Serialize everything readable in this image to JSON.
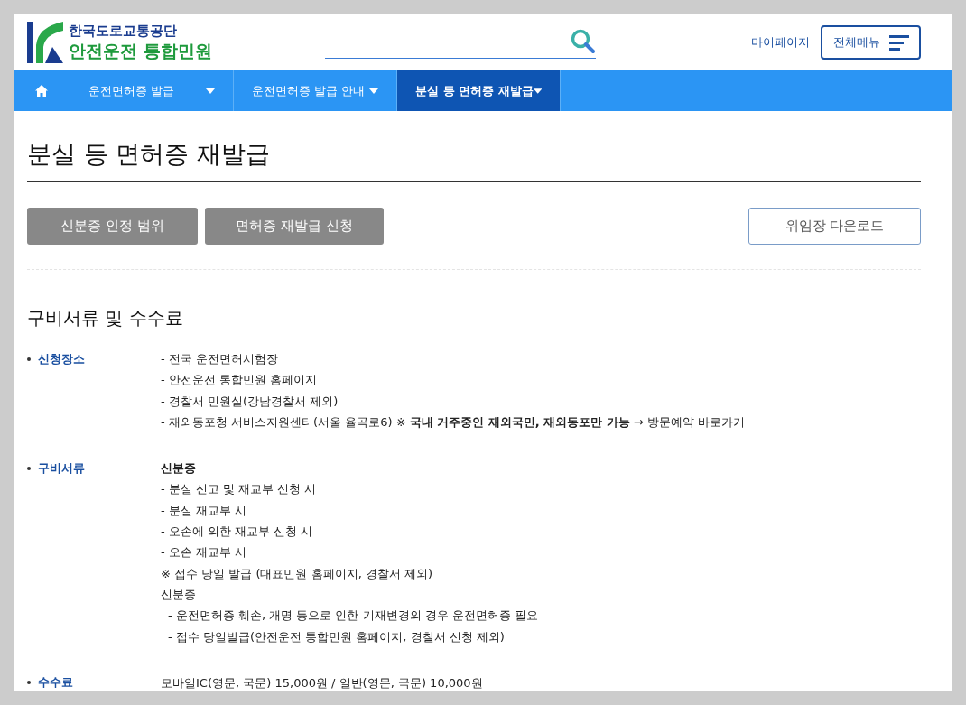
{
  "header": {
    "org_name": "한국도로교통공단",
    "site_name": "안전운전 통합민원",
    "mypage_link": "마이페이지",
    "menu_button": "전체메뉴"
  },
  "nav": [
    {
      "label": "운전면허증 발급",
      "selected": false
    },
    {
      "label": "운전면허증 발급 안내",
      "selected": false
    },
    {
      "label": "분실 등 면허증 재발급",
      "selected": true
    }
  ],
  "page_title": "분실 등 면허증 재발급",
  "action_buttons": [
    {
      "label": "신분증 인정 범위",
      "kind": "filled"
    },
    {
      "label": "면허증 재발급 신청",
      "kind": "filled"
    },
    {
      "label": "위임장 다운로드",
      "kind": "outline"
    }
  ],
  "section_title": "구비서류 및 수수료",
  "items": [
    {
      "label": "신청장소",
      "lines": [
        {
          "kind": "plain",
          "text": "- 전국 운전면허시험장"
        },
        {
          "kind": "plain",
          "text": "- 안전운전 통합민원 홈페이지"
        },
        {
          "kind": "plain",
          "text": "- 경찰서 민원실(강남경찰서 제외)"
        },
        {
          "kind": "plain",
          "text": "- 재외동포청 서비스지원센터(서울 율곡로6) ※ **국내 거주중인 재외국민, 재외동포만 가능** → 방문예약 바로가기"
        }
      ]
    },
    {
      "label": "구비서류",
      "lines": [
        {
          "kind": "bold",
          "text": "신분증"
        },
        {
          "kind": "plain",
          "text": "- 분실 신고 및 재교부 신청 시"
        },
        {
          "kind": "plain",
          "text": "- 분실 재교부 시"
        },
        {
          "kind": "plain",
          "text": "- 오손에 의한 재교부 신청 시"
        },
        {
          "kind": "plain",
          "text": "- 오손 재교부 시"
        },
        {
          "kind": "plain",
          "text": "※ 접수 당일 발급 (대표민원 홈페이지, 경찰서 제외)"
        },
        {
          "kind": "plain",
          "text": "신분증"
        },
        {
          "kind": "indent",
          "text": "- 운전면허증 훼손, 개명 등으로 인한 기재변경의 경우 운전면허증 필요"
        },
        {
          "kind": "indent",
          "text": "- 접수 당일발급(안전운전 통합민원 홈페이지, 경찰서 신청 제외)"
        }
      ]
    },
    {
      "label": "수수료",
      "lines": [
        {
          "kind": "plain",
          "text": "모바일IC(영문, 국문) 15,000원 / 일반(영문, 국문) 10,000원"
        }
      ]
    }
  ]
}
